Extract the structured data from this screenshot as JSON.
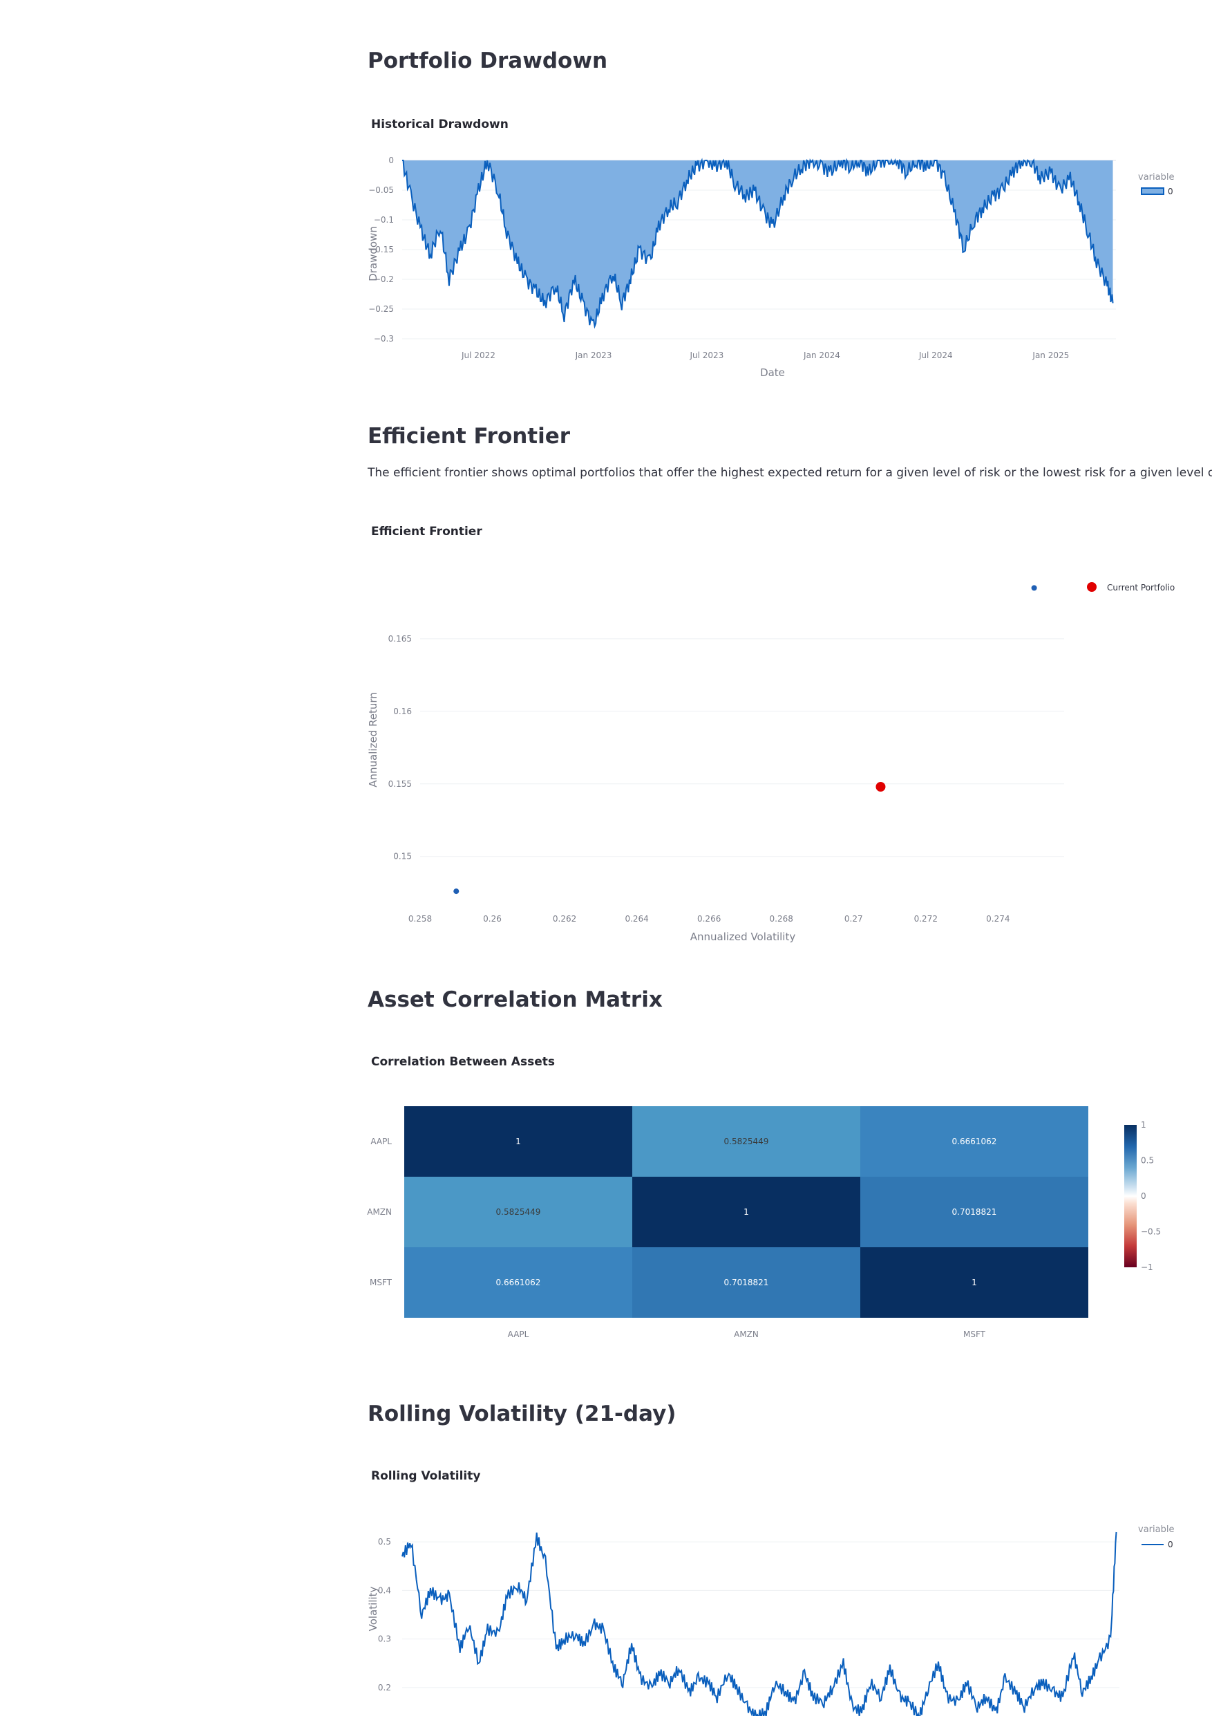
{
  "sections": {
    "drawdown": {
      "title": "Portfolio Drawdown",
      "chart_title": "Historical Drawdown"
    },
    "frontier": {
      "title": "Efficient Frontier",
      "description": "The efficient frontier shows optimal portfolios that offer the highest expected return for a given level of risk or the lowest risk for a given level of return.",
      "chart_title": "Efficient Frontier"
    },
    "correlation": {
      "title": "Asset Correlation Matrix",
      "chart_title": "Correlation Between Assets"
    },
    "volatility": {
      "title": "Rolling Volatility (21-day)",
      "chart_title": "Rolling Volatility"
    }
  },
  "colors": {
    "line": "#0a5fbd",
    "area_fill": "#7fb0e3",
    "current_portfolio": "#e00000",
    "frontier_point": "#1f5fb4",
    "heat_high": "#082f61",
    "heat_mid": "#3a84bf",
    "heat_low": "#b40f2a"
  },
  "chart_data": [
    {
      "id": "drawdown",
      "type": "area",
      "xlabel": "Date",
      "ylabel": "Drawdown",
      "x_tick_labels": [
        "Jul 2022",
        "Jan 2023",
        "Jul 2023",
        "Jan 2024",
        "Jul 2024",
        "Jan 2025"
      ],
      "x_tick_dates": [
        "2022-07-01",
        "2023-01-01",
        "2023-07-01",
        "2024-01-01",
        "2024-07-01",
        "2025-01-01"
      ],
      "xlim": [
        "2022-03-01",
        "2025-04-15"
      ],
      "y_tick_labels": [
        "0",
        "−0.05",
        "−0.1",
        "−0.15",
        "−0.2",
        "−0.25",
        "−0.3"
      ],
      "y_ticks": [
        0,
        -0.05,
        -0.1,
        -0.15,
        -0.2,
        -0.25,
        -0.3
      ],
      "ylim": [
        -0.3,
        0
      ],
      "legend": {
        "title": "variable",
        "placement": "top-right",
        "items": [
          "0"
        ]
      },
      "series": [
        {
          "name": "0",
          "x": [
            "2022-03-01",
            "2022-03-15",
            "2022-04-01",
            "2022-04-15",
            "2022-05-01",
            "2022-05-15",
            "2022-06-01",
            "2022-06-15",
            "2022-07-01",
            "2022-07-15",
            "2022-08-01",
            "2022-08-15",
            "2022-09-01",
            "2022-09-15",
            "2022-10-01",
            "2022-10-15",
            "2022-11-01",
            "2022-11-15",
            "2022-12-01",
            "2022-12-15",
            "2023-01-01",
            "2023-01-15",
            "2023-02-01",
            "2023-02-15",
            "2023-03-01",
            "2023-03-15",
            "2023-04-01",
            "2023-04-15",
            "2023-05-01",
            "2023-05-15",
            "2023-06-01",
            "2023-06-15",
            "2023-07-01",
            "2023-07-15",
            "2023-08-01",
            "2023-08-15",
            "2023-09-01",
            "2023-09-15",
            "2023-10-01",
            "2023-10-15",
            "2023-11-01",
            "2023-11-15",
            "2023-12-01",
            "2023-12-15",
            "2024-01-01",
            "2024-01-15",
            "2024-02-01",
            "2024-02-15",
            "2024-03-01",
            "2024-03-15",
            "2024-04-01",
            "2024-04-15",
            "2024-05-01",
            "2024-05-15",
            "2024-06-01",
            "2024-06-15",
            "2024-07-01",
            "2024-07-15",
            "2024-08-01",
            "2024-08-15",
            "2024-09-01",
            "2024-09-15",
            "2024-10-01",
            "2024-10-15",
            "2024-11-01",
            "2024-11-15",
            "2024-12-01",
            "2024-12-15",
            "2025-01-01",
            "2025-01-15",
            "2025-02-01",
            "2025-02-15",
            "2025-03-01",
            "2025-03-15",
            "2025-04-01",
            "2025-04-10"
          ],
          "values": [
            0,
            -0.06,
            -0.12,
            -0.16,
            -0.11,
            -0.2,
            -0.15,
            -0.12,
            -0.05,
            0,
            -0.05,
            -0.12,
            -0.17,
            -0.2,
            -0.22,
            -0.24,
            -0.21,
            -0.26,
            -0.2,
            -0.24,
            -0.28,
            -0.23,
            -0.19,
            -0.24,
            -0.2,
            -0.15,
            -0.17,
            -0.11,
            -0.08,
            -0.07,
            -0.03,
            -0.01,
            0,
            -0.01,
            0,
            -0.04,
            -0.06,
            -0.05,
            -0.09,
            -0.11,
            -0.06,
            -0.03,
            -0.01,
            0,
            -0.01,
            -0.02,
            0,
            -0.01,
            0,
            -0.02,
            0,
            0,
            0,
            -0.02,
            0,
            -0.01,
            0,
            -0.03,
            -0.09,
            -0.15,
            -0.1,
            -0.08,
            -0.06,
            -0.05,
            -0.02,
            0,
            0,
            -0.03,
            -0.02,
            -0.05,
            -0.03,
            -0.07,
            -0.12,
            -0.17,
            -0.21,
            -0.24
          ]
        }
      ]
    },
    {
      "id": "frontier",
      "type": "scatter",
      "xlabel": "Annualized Volatility",
      "ylabel": "Annualized Return",
      "x_tick_labels": [
        "0.258",
        "0.26",
        "0.262",
        "0.264",
        "0.266",
        "0.268",
        "0.27",
        "0.272",
        "0.274"
      ],
      "x_ticks": [
        0.258,
        0.26,
        0.262,
        0.264,
        0.266,
        0.268,
        0.27,
        0.272,
        0.274
      ],
      "xlim": [
        0.258,
        0.27583
      ],
      "y_tick_labels": [
        "0.165",
        "0.16",
        "0.155",
        "0.15"
      ],
      "y_ticks": [
        0.165,
        0.16,
        0.155,
        0.15
      ],
      "ylim": [
        0.14708,
        0.16909
      ],
      "legend": {
        "placement": "top-right",
        "items": [
          "Current Portfolio"
        ]
      },
      "series": [
        {
          "name": "",
          "x": [
            0.259,
            0.275
          ],
          "y": [
            0.1476,
            0.1685
          ]
        },
        {
          "name": "Current Portfolio",
          "x": [
            0.27075
          ],
          "y": [
            0.1548
          ]
        }
      ]
    },
    {
      "id": "correlation",
      "type": "heatmap",
      "x_categories": [
        "AAPL",
        "AMZN",
        "MSFT"
      ],
      "y_categories": [
        "AAPL",
        "AMZN",
        "MSFT"
      ],
      "values": [
        [
          1,
          0.5825449,
          0.6661062
        ],
        [
          0.5825449,
          1,
          0.7018821
        ],
        [
          0.6661062,
          0.7018821,
          1
        ]
      ],
      "value_labels": [
        [
          "1",
          "0.5825449",
          "0.6661062"
        ],
        [
          "0.5825449",
          "1",
          "0.7018821"
        ],
        [
          "0.6661062",
          "0.7018821",
          "1"
        ]
      ],
      "colorbar": {
        "range": [
          -1,
          1
        ],
        "tick_labels": [
          "1",
          "0.5",
          "0",
          "−0.5",
          "−1"
        ],
        "ticks": [
          1,
          0.5,
          0,
          -0.5,
          -1
        ]
      }
    },
    {
      "id": "volatility",
      "type": "line",
      "ylabel": "Volatility",
      "y_tick_labels": [
        "0.5",
        "0.4",
        "0.3",
        "0.2"
      ],
      "y_ticks": [
        0.5,
        0.4,
        0.3,
        0.2
      ],
      "ylim": [
        0.13,
        0.54
      ],
      "xlim": [
        "2022-03-01",
        "2025-04-15"
      ],
      "legend": {
        "title": "variable",
        "placement": "top-right",
        "items": [
          "0"
        ]
      },
      "series": [
        {
          "name": "0",
          "x": [
            "2022-03-01",
            "2022-03-15",
            "2022-04-01",
            "2022-04-15",
            "2022-05-01",
            "2022-05-15",
            "2022-06-01",
            "2022-06-15",
            "2022-07-01",
            "2022-07-15",
            "2022-08-01",
            "2022-08-15",
            "2022-09-01",
            "2022-09-15",
            "2022-10-01",
            "2022-10-15",
            "2022-11-01",
            "2022-11-15",
            "2022-12-01",
            "2022-12-15",
            "2023-01-01",
            "2023-01-15",
            "2023-02-01",
            "2023-02-15",
            "2023-03-01",
            "2023-03-15",
            "2023-04-01",
            "2023-04-15",
            "2023-05-01",
            "2023-05-15",
            "2023-06-01",
            "2023-06-15",
            "2023-07-01",
            "2023-07-15",
            "2023-08-01",
            "2023-08-15",
            "2023-09-01",
            "2023-09-15",
            "2023-10-01",
            "2023-10-15",
            "2023-11-01",
            "2023-11-15",
            "2023-12-01",
            "2023-12-15",
            "2024-01-01",
            "2024-01-15",
            "2024-02-01",
            "2024-02-15",
            "2024-03-01",
            "2024-03-15",
            "2024-04-01",
            "2024-04-15",
            "2024-05-01",
            "2024-05-15",
            "2024-06-01",
            "2024-06-15",
            "2024-07-01",
            "2024-07-15",
            "2024-08-01",
            "2024-08-15",
            "2024-09-01",
            "2024-09-15",
            "2024-10-01",
            "2024-10-15",
            "2024-11-01",
            "2024-11-15",
            "2024-12-01",
            "2024-12-15",
            "2025-01-01",
            "2025-01-15",
            "2025-02-01",
            "2025-02-15",
            "2025-03-01",
            "2025-03-15",
            "2025-04-01",
            "2025-04-10"
          ],
          "values": [
            0.47,
            0.5,
            0.35,
            0.4,
            0.38,
            0.39,
            0.28,
            0.33,
            0.25,
            0.32,
            0.31,
            0.39,
            0.41,
            0.38,
            0.51,
            0.46,
            0.28,
            0.3,
            0.31,
            0.29,
            0.33,
            0.32,
            0.24,
            0.21,
            0.29,
            0.22,
            0.2,
            0.23,
            0.21,
            0.24,
            0.19,
            0.22,
            0.21,
            0.18,
            0.23,
            0.2,
            0.16,
            0.14,
            0.15,
            0.21,
            0.19,
            0.17,
            0.23,
            0.18,
            0.17,
            0.2,
            0.25,
            0.16,
            0.15,
            0.21,
            0.18,
            0.24,
            0.18,
            0.17,
            0.14,
            0.2,
            0.25,
            0.18,
            0.17,
            0.21,
            0.16,
            0.18,
            0.15,
            0.22,
            0.19,
            0.16,
            0.2,
            0.21,
            0.19,
            0.18,
            0.27,
            0.19,
            0.22,
            0.26,
            0.3,
            0.52
          ]
        }
      ]
    }
  ]
}
